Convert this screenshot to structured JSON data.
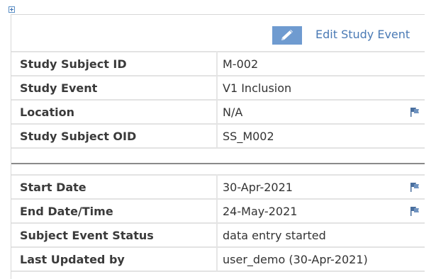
{
  "header": {
    "edit_link_label": "Edit Study Event",
    "edit_icon": "pencil-icon"
  },
  "subject_info": [
    {
      "label": "Study Subject ID",
      "value": "M-002",
      "flag": false
    },
    {
      "label": "Study Event",
      "value": "V1 Inclusion",
      "flag": false
    },
    {
      "label": "Location",
      "value": "N/A",
      "flag": true
    },
    {
      "label": "Study Subject OID",
      "value": "SS_M002",
      "flag": false
    }
  ],
  "event_info": [
    {
      "label": "Start Date",
      "value": "30-Apr-2021",
      "flag": true
    },
    {
      "label": "End Date/Time",
      "value": "24-May-2021",
      "flag": true
    },
    {
      "label": "Subject Event Status",
      "value": "data entry started",
      "flag": false
    },
    {
      "label": "Last Updated by",
      "value": "user_demo (30-Apr-2021)",
      "flag": false
    }
  ],
  "colors": {
    "link": "#4a7ab5",
    "edit_icon_bg": "#6f9bd0",
    "flag": "#4a6f9e",
    "border": "#e3e3e3"
  }
}
